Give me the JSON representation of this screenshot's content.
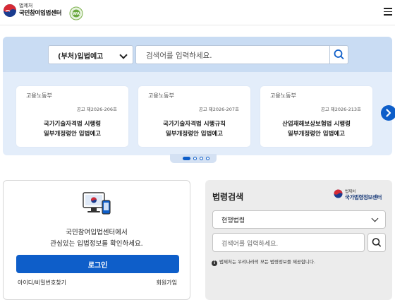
{
  "header": {
    "org_small": "법제처",
    "org_main": "국민참여입법센터",
    "cert_badge_icon": "web-accessibility-mark-icon",
    "menu_icon": "hamburger-menu-icon"
  },
  "top_search": {
    "category_selected": "(부처)입법예고",
    "placeholder": "검색어를 입력하세요."
  },
  "notice_cards": [
    {
      "ministry": "고용노동부",
      "notice_no": "공고 제2026-206호",
      "title_line1": "국가기술자격법 시행령",
      "title_line2": "일부개정령안 입법예고"
    },
    {
      "ministry": "고용노동부",
      "notice_no": "공고 제2026-207호",
      "title_line1": "국가기술자격법 시행규칙",
      "title_line2": "일부개정령안 입법예고"
    },
    {
      "ministry": "고용노동부",
      "notice_no": "공고 제2026-213호",
      "title_line1": "산업재해보상보험법 시행령",
      "title_line2": "일부개정령안 입법예고"
    }
  ],
  "pager": {
    "pages": 4,
    "active": 1
  },
  "login": {
    "message_line1": "국민참여입법센터에서",
    "message_line2": "관심있는 입법정보를 확인하세요.",
    "login_label": "로그인",
    "find_label": "아이디/비밀번호찾기",
    "join_label": "회원가입"
  },
  "law_search": {
    "title": "법령검색",
    "logo_small": "법제처",
    "logo_main": "국가법령정보센터",
    "select_value": "현행법령",
    "placeholder": "검색어를 입력하세요.",
    "note": "법제처는 우리나라의 모든 법령정보를 제공합니다."
  },
  "colors": {
    "primary": "#0e5ec9",
    "band_bg": "#e3edfa",
    "search_bar_bg": "#c9dcf3",
    "law_panel_bg": "#ececec"
  }
}
